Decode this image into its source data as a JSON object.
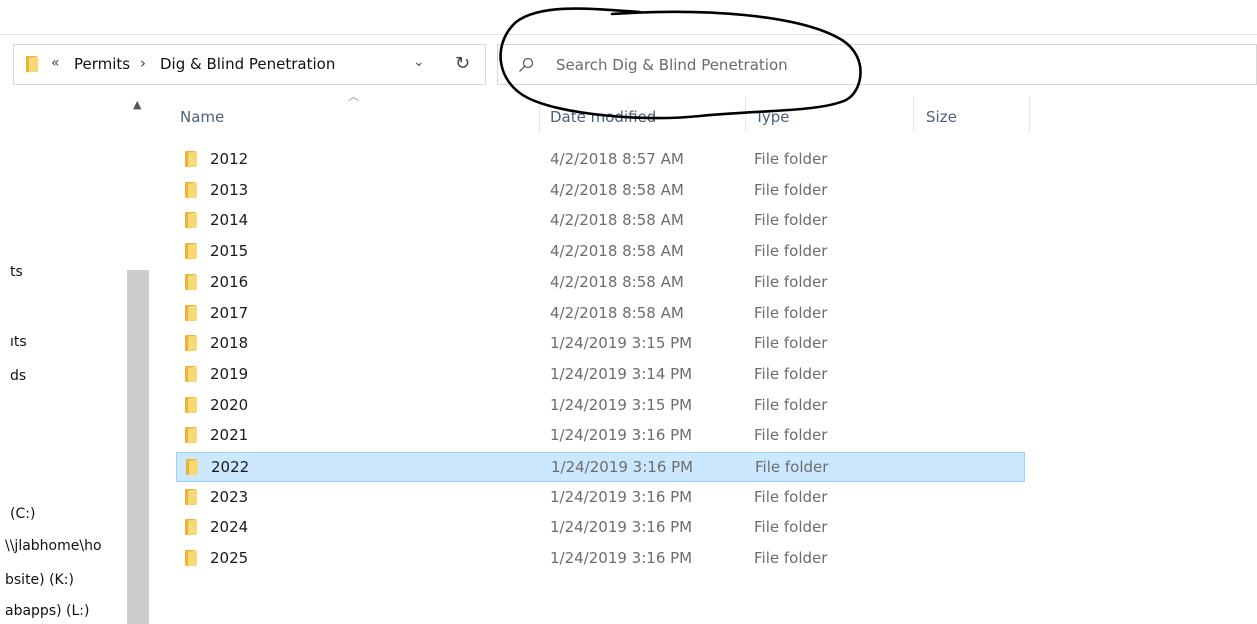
{
  "address": {
    "overflow_glyph": "«",
    "breadcrumbs": [
      "Permits",
      "Dig & Blind Penetration"
    ],
    "separator": "›",
    "dropdown_glyph": "⌄",
    "refresh_glyph": "↻"
  },
  "search": {
    "placeholder": "Search Dig & Blind Penetration"
  },
  "columns": {
    "name": "Name",
    "date": "Date modified",
    "type": "Type",
    "size": "Size",
    "sort_glyph": "︿"
  },
  "nav": {
    "scroll_up_glyph": "▲",
    "items": [
      "ts",
      "ıts",
      "ds",
      "(C:)",
      "\\\\jlabhome\\ho",
      "bsite) (K:)",
      "abapps) (L:)"
    ]
  },
  "files": [
    {
      "name": "2012",
      "date": "4/2/2018 8:57 AM",
      "type": "File folder",
      "selected": false
    },
    {
      "name": "2013",
      "date": "4/2/2018 8:58 AM",
      "type": "File folder",
      "selected": false
    },
    {
      "name": "2014",
      "date": "4/2/2018 8:58 AM",
      "type": "File folder",
      "selected": false
    },
    {
      "name": "2015",
      "date": "4/2/2018 8:58 AM",
      "type": "File folder",
      "selected": false
    },
    {
      "name": "2016",
      "date": "4/2/2018 8:58 AM",
      "type": "File folder",
      "selected": false
    },
    {
      "name": "2017",
      "date": "4/2/2018 8:58 AM",
      "type": "File folder",
      "selected": false
    },
    {
      "name": "2018",
      "date": "1/24/2019 3:15 PM",
      "type": "File folder",
      "selected": false
    },
    {
      "name": "2019",
      "date": "1/24/2019 3:14 PM",
      "type": "File folder",
      "selected": false
    },
    {
      "name": "2020",
      "date": "1/24/2019 3:15 PM",
      "type": "File folder",
      "selected": false
    },
    {
      "name": "2021",
      "date": "1/24/2019 3:16 PM",
      "type": "File folder",
      "selected": false
    },
    {
      "name": "2022",
      "date": "1/24/2019 3:16 PM",
      "type": "File folder",
      "selected": true
    },
    {
      "name": "2023",
      "date": "1/24/2019 3:16 PM",
      "type": "File folder",
      "selected": false
    },
    {
      "name": "2024",
      "date": "1/24/2019 3:16 PM",
      "type": "File folder",
      "selected": false
    },
    {
      "name": "2025",
      "date": "1/24/2019 3:16 PM",
      "type": "File folder",
      "selected": false
    }
  ],
  "colors": {
    "selection_bg": "#cce8ff",
    "selection_border": "#99d1ff",
    "folder_yellow": "#f9d976",
    "header_text": "#4c607a",
    "annotation_ink": "#000000"
  }
}
